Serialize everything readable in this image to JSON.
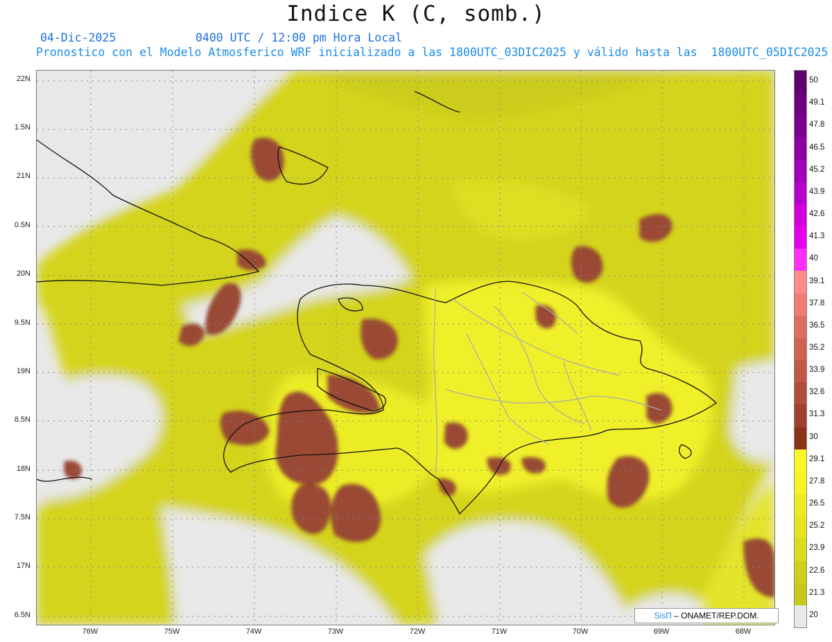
{
  "header": {
    "title": "Indice K (C, somb.)",
    "date": "04-Dic-2025",
    "time": "0400 UTC / 12:00 pm Hora Local",
    "description": "Pronostico con el Modelo Atmosferico WRF inicializado a las 1800UTC_03DIC2025 y válido hasta las  1800UTC_05DIC2025"
  },
  "axes": {
    "lat_labels": [
      "22N",
      "1.5N",
      "21N",
      "0.5N",
      "20N",
      "9.5N",
      "19N",
      "8.5N",
      "18N",
      "7.5N",
      "17N",
      "6.5N"
    ],
    "lon_labels": [
      "76W",
      "75W",
      "74W",
      "73W",
      "72W",
      "71W",
      "70W",
      "69W",
      "68W"
    ]
  },
  "colorbar": {
    "labels": [
      "50",
      "49.1",
      "47.8",
      "46.5",
      "45.2",
      "43.9",
      "42.6",
      "41.3",
      "40",
      "39.1",
      "37.8",
      "36.5",
      "35.2",
      "33.9",
      "32.6",
      "31.3",
      "30",
      "29.1",
      "27.8",
      "26.5",
      "25.2",
      "23.9",
      "22.6",
      "21.3",
      "20"
    ],
    "colors": [
      "#5e0070",
      "#6c0080",
      "#7c0090",
      "#8c00a4",
      "#a000b8",
      "#b800cc",
      "#d000dd",
      "#e400e8",
      "#ff2eff",
      "#ff8a8a",
      "#f07c72",
      "#e06e60",
      "#d06450",
      "#c05844",
      "#b04c38",
      "#a0402e",
      "#8c3418",
      "#f8f828",
      "#f4f424",
      "#ecec22",
      "#e4e420",
      "#dcdc1e",
      "#d0d01c",
      "#c8c81a",
      "#e8e8e8"
    ]
  },
  "colors": {
    "land_outline": "#111111",
    "province_outline": "#aaaaaa",
    "no_data": "#e8e8e8",
    "field_low": "#cfcf1e",
    "field_mid": "#e8e830",
    "field_high": "#f8f826",
    "k_above_30": "#9a4836"
  },
  "credit": {
    "sis": "SisΠ",
    "rest": "– ONAMET/REP.DOM."
  }
}
